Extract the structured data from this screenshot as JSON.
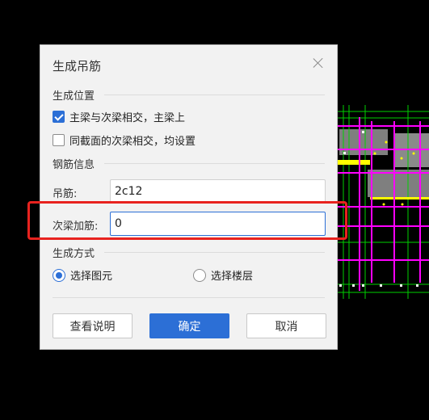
{
  "dialog": {
    "title": "生成吊筋",
    "sections": {
      "position": "生成位置",
      "rebar_info": "钢筋信息",
      "method": "生成方式"
    },
    "options": {
      "main_secondary": "主梁与次梁相交，主梁上",
      "same_section": "同截面的次梁相交，均设置"
    },
    "fields": {
      "hanger_label": "吊筋:",
      "hanger_value": "2c12",
      "extra_label": "次梁加筋:",
      "extra_value": "0"
    },
    "method": {
      "select_element": "选择图元",
      "select_floor": "选择楼层"
    },
    "buttons": {
      "help": "查看说明",
      "ok": "确定",
      "cancel": "取消"
    }
  },
  "colors": {
    "accent": "#2c6fd6",
    "highlight": "#e8231f",
    "dialog_bg": "#f2f2f2"
  }
}
